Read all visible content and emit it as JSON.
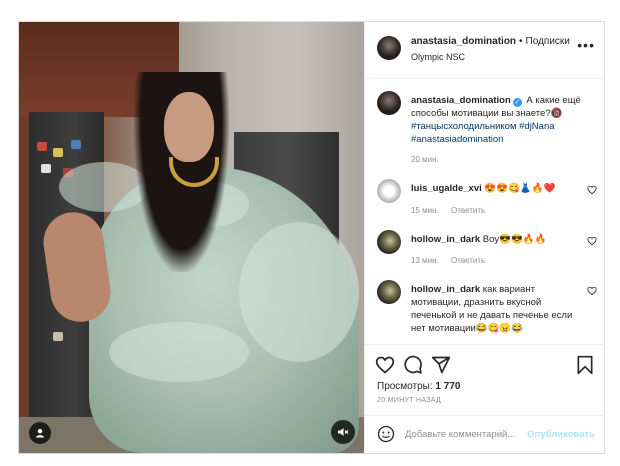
{
  "post": {
    "username": "anastasia_domination",
    "separator": "•",
    "follow_label": "Подписки",
    "location": "Olympic NSC",
    "more_label": "•••"
  },
  "caption": {
    "username": "anastasia_domination",
    "verified_mark": "✓",
    "text": "А какие ещё способы мотивации вы знаете?🔞",
    "hashtags": "#танцысхолодильником #djNana #anastasiadomination",
    "time": "20 мин."
  },
  "comments": [
    {
      "username": "luis_ugalde_xvi",
      "text": "😍😍😋👗🔥❤️",
      "time": "15 мин.",
      "reply_label": "Ответить"
    },
    {
      "username": "hollow_in_dark",
      "text": "Boy😎😎🔥🔥",
      "time": "13 мин.",
      "reply_label": "Ответить"
    },
    {
      "username": "hollow_in_dark",
      "text": "как вариант мотивации, дразнить вкусной печенькой и не давать печенье если нет мотивации😂😋😠😂"
    }
  ],
  "stats": {
    "views_label": "Просмотры:",
    "views_value": "1 770",
    "posted": "20 МИНУТ НАЗАД"
  },
  "add_comment": {
    "placeholder": "Добавьте комментарий...",
    "post_label": "Опубликовать"
  },
  "icons": {
    "like": "heart-icon",
    "comment": "comment-icon",
    "share": "share-icon",
    "save": "bookmark-icon",
    "emoji": "smile-icon",
    "sound": "speaker-muted-icon",
    "tagged": "user-icon"
  },
  "colors": {
    "link": "#00376b",
    "verified": "#3897f0",
    "muted": "#8e8e8e",
    "post_disabled": "#b2dffc"
  }
}
